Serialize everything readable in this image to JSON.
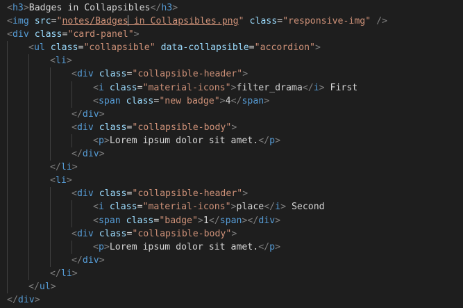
{
  "editor": {
    "lines": [
      {
        "indent": 0,
        "tokens": [
          {
            "t": "<",
            "c": "punct"
          },
          {
            "t": "h3",
            "c": "tag"
          },
          {
            "t": ">",
            "c": "punct"
          },
          {
            "t": "Badges in Collapsibles",
            "c": "txt"
          },
          {
            "t": "</",
            "c": "punct"
          },
          {
            "t": "h3",
            "c": "tag"
          },
          {
            "t": ">",
            "c": "punct"
          }
        ]
      },
      {
        "indent": 0,
        "tokens": [
          {
            "t": "<",
            "c": "punct"
          },
          {
            "t": "img",
            "c": "tag"
          },
          {
            "t": " ",
            "c": "txt"
          },
          {
            "t": "src",
            "c": "attr"
          },
          {
            "t": "=",
            "c": "txt"
          },
          {
            "t": "\"",
            "c": "str"
          },
          {
            "t": "notes/Badges",
            "c": "str link"
          },
          {
            "t": "",
            "c": "cursor"
          },
          {
            "t": " in Collapsibles.png",
            "c": "str link"
          },
          {
            "t": "\"",
            "c": "str"
          },
          {
            "t": " ",
            "c": "txt"
          },
          {
            "t": "class",
            "c": "attr"
          },
          {
            "t": "=",
            "c": "txt"
          },
          {
            "t": "\"responsive-img\"",
            "c": "str"
          },
          {
            "t": " />",
            "c": "punct"
          }
        ]
      },
      {
        "indent": 0,
        "tokens": [
          {
            "t": "<",
            "c": "punct"
          },
          {
            "t": "div",
            "c": "tag"
          },
          {
            "t": " ",
            "c": "txt"
          },
          {
            "t": "class",
            "c": "attr"
          },
          {
            "t": "=",
            "c": "txt"
          },
          {
            "t": "\"card-panel\"",
            "c": "str"
          },
          {
            "t": ">",
            "c": "punct"
          }
        ]
      },
      {
        "indent": 1,
        "tokens": [
          {
            "t": "<",
            "c": "punct"
          },
          {
            "t": "ul",
            "c": "tag"
          },
          {
            "t": " ",
            "c": "txt"
          },
          {
            "t": "class",
            "c": "attr"
          },
          {
            "t": "=",
            "c": "txt"
          },
          {
            "t": "\"collapsible\"",
            "c": "str"
          },
          {
            "t": " ",
            "c": "txt"
          },
          {
            "t": "data-collapsible",
            "c": "attr"
          },
          {
            "t": "=",
            "c": "txt"
          },
          {
            "t": "\"accordion\"",
            "c": "str"
          },
          {
            "t": ">",
            "c": "punct"
          }
        ]
      },
      {
        "indent": 2,
        "tokens": [
          {
            "t": "<",
            "c": "punct"
          },
          {
            "t": "li",
            "c": "tag"
          },
          {
            "t": ">",
            "c": "punct"
          }
        ]
      },
      {
        "indent": 3,
        "tokens": [
          {
            "t": "<",
            "c": "punct"
          },
          {
            "t": "div",
            "c": "tag"
          },
          {
            "t": " ",
            "c": "txt"
          },
          {
            "t": "class",
            "c": "attr"
          },
          {
            "t": "=",
            "c": "txt"
          },
          {
            "t": "\"collapsible-header\"",
            "c": "str"
          },
          {
            "t": ">",
            "c": "punct"
          }
        ]
      },
      {
        "indent": 4,
        "tokens": [
          {
            "t": "<",
            "c": "punct"
          },
          {
            "t": "i",
            "c": "tag"
          },
          {
            "t": " ",
            "c": "txt"
          },
          {
            "t": "class",
            "c": "attr"
          },
          {
            "t": "=",
            "c": "txt"
          },
          {
            "t": "\"material-icons\"",
            "c": "str"
          },
          {
            "t": ">",
            "c": "punct"
          },
          {
            "t": "filter_drama",
            "c": "txt"
          },
          {
            "t": "</",
            "c": "punct"
          },
          {
            "t": "i",
            "c": "tag"
          },
          {
            "t": ">",
            "c": "punct"
          },
          {
            "t": " First",
            "c": "txt"
          }
        ]
      },
      {
        "indent": 4,
        "tokens": [
          {
            "t": "<",
            "c": "punct"
          },
          {
            "t": "span",
            "c": "tag"
          },
          {
            "t": " ",
            "c": "txt"
          },
          {
            "t": "class",
            "c": "attr"
          },
          {
            "t": "=",
            "c": "txt"
          },
          {
            "t": "\"new badge\"",
            "c": "str"
          },
          {
            "t": ">",
            "c": "punct"
          },
          {
            "t": "4",
            "c": "txt"
          },
          {
            "t": "</",
            "c": "punct"
          },
          {
            "t": "span",
            "c": "tag"
          },
          {
            "t": ">",
            "c": "punct"
          }
        ]
      },
      {
        "indent": 3,
        "tokens": [
          {
            "t": "</",
            "c": "punct"
          },
          {
            "t": "div",
            "c": "tag"
          },
          {
            "t": ">",
            "c": "punct"
          }
        ]
      },
      {
        "indent": 3,
        "tokens": [
          {
            "t": "<",
            "c": "punct"
          },
          {
            "t": "div",
            "c": "tag"
          },
          {
            "t": " ",
            "c": "txt"
          },
          {
            "t": "class",
            "c": "attr"
          },
          {
            "t": "=",
            "c": "txt"
          },
          {
            "t": "\"collapsible-body\"",
            "c": "str"
          },
          {
            "t": ">",
            "c": "punct"
          }
        ]
      },
      {
        "indent": 4,
        "tokens": [
          {
            "t": "<",
            "c": "punct"
          },
          {
            "t": "p",
            "c": "tag"
          },
          {
            "t": ">",
            "c": "punct"
          },
          {
            "t": "Lorem ipsum dolor sit amet.",
            "c": "txt"
          },
          {
            "t": "</",
            "c": "punct"
          },
          {
            "t": "p",
            "c": "tag"
          },
          {
            "t": ">",
            "c": "punct"
          }
        ]
      },
      {
        "indent": 3,
        "tokens": [
          {
            "t": "</",
            "c": "punct"
          },
          {
            "t": "div",
            "c": "tag"
          },
          {
            "t": ">",
            "c": "punct"
          }
        ]
      },
      {
        "indent": 2,
        "tokens": [
          {
            "t": "</",
            "c": "punct"
          },
          {
            "t": "li",
            "c": "tag"
          },
          {
            "t": ">",
            "c": "punct"
          }
        ]
      },
      {
        "indent": 2,
        "tokens": [
          {
            "t": "<",
            "c": "punct"
          },
          {
            "t": "li",
            "c": "tag"
          },
          {
            "t": ">",
            "c": "punct"
          }
        ]
      },
      {
        "indent": 3,
        "tokens": [
          {
            "t": "<",
            "c": "punct"
          },
          {
            "t": "div",
            "c": "tag"
          },
          {
            "t": " ",
            "c": "txt"
          },
          {
            "t": "class",
            "c": "attr"
          },
          {
            "t": "=",
            "c": "txt"
          },
          {
            "t": "\"collapsible-header\"",
            "c": "str"
          },
          {
            "t": ">",
            "c": "punct"
          }
        ]
      },
      {
        "indent": 4,
        "tokens": [
          {
            "t": "<",
            "c": "punct"
          },
          {
            "t": "i",
            "c": "tag"
          },
          {
            "t": " ",
            "c": "txt"
          },
          {
            "t": "class",
            "c": "attr"
          },
          {
            "t": "=",
            "c": "txt"
          },
          {
            "t": "\"material-icons\"",
            "c": "str"
          },
          {
            "t": ">",
            "c": "punct"
          },
          {
            "t": "place",
            "c": "txt"
          },
          {
            "t": "</",
            "c": "punct"
          },
          {
            "t": "i",
            "c": "tag"
          },
          {
            "t": ">",
            "c": "punct"
          },
          {
            "t": " Second",
            "c": "txt"
          }
        ]
      },
      {
        "indent": 4,
        "tokens": [
          {
            "t": "<",
            "c": "punct"
          },
          {
            "t": "span",
            "c": "tag"
          },
          {
            "t": " ",
            "c": "txt"
          },
          {
            "t": "class",
            "c": "attr"
          },
          {
            "t": "=",
            "c": "txt"
          },
          {
            "t": "\"badge\"",
            "c": "str"
          },
          {
            "t": ">",
            "c": "punct"
          },
          {
            "t": "1",
            "c": "txt"
          },
          {
            "t": "</",
            "c": "punct"
          },
          {
            "t": "span",
            "c": "tag"
          },
          {
            "t": ">",
            "c": "punct"
          },
          {
            "t": "</",
            "c": "punct"
          },
          {
            "t": "div",
            "c": "tag"
          },
          {
            "t": ">",
            "c": "punct"
          }
        ]
      },
      {
        "indent": 3,
        "tokens": [
          {
            "t": "<",
            "c": "punct"
          },
          {
            "t": "div",
            "c": "tag"
          },
          {
            "t": " ",
            "c": "txt"
          },
          {
            "t": "class",
            "c": "attr"
          },
          {
            "t": "=",
            "c": "txt"
          },
          {
            "t": "\"collapsible-body\"",
            "c": "str"
          },
          {
            "t": ">",
            "c": "punct"
          }
        ]
      },
      {
        "indent": 4,
        "tokens": [
          {
            "t": "<",
            "c": "punct"
          },
          {
            "t": "p",
            "c": "tag"
          },
          {
            "t": ">",
            "c": "punct"
          },
          {
            "t": "Lorem ipsum dolor sit amet.",
            "c": "txt"
          },
          {
            "t": "</",
            "c": "punct"
          },
          {
            "t": "p",
            "c": "tag"
          },
          {
            "t": ">",
            "c": "punct"
          }
        ]
      },
      {
        "indent": 3,
        "tokens": [
          {
            "t": "</",
            "c": "punct"
          },
          {
            "t": "div",
            "c": "tag"
          },
          {
            "t": ">",
            "c": "punct"
          }
        ]
      },
      {
        "indent": 2,
        "tokens": [
          {
            "t": "</",
            "c": "punct"
          },
          {
            "t": "li",
            "c": "tag"
          },
          {
            "t": ">",
            "c": "punct"
          }
        ]
      },
      {
        "indent": 1,
        "tokens": [
          {
            "t": "</",
            "c": "punct"
          },
          {
            "t": "ul",
            "c": "tag"
          },
          {
            "t": ">",
            "c": "punct"
          }
        ]
      },
      {
        "indent": 0,
        "tokens": [
          {
            "t": "</",
            "c": "punct"
          },
          {
            "t": "div",
            "c": "tag"
          },
          {
            "t": ">",
            "c": "punct"
          }
        ]
      }
    ]
  }
}
